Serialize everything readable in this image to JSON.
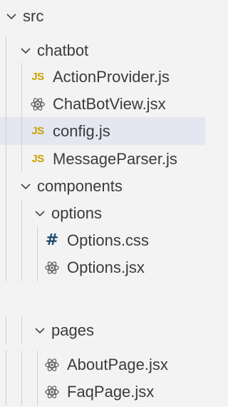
{
  "explorer": {
    "items": [
      {
        "label": "src",
        "type": "folder",
        "expanded": true
      },
      {
        "label": "chatbot",
        "type": "folder",
        "expanded": true
      },
      {
        "label": "ActionProvider.js",
        "type": "file",
        "icon": "js-icon",
        "icon_text": "JS"
      },
      {
        "label": "ChatBotView.jsx",
        "type": "file",
        "icon": "react-icon"
      },
      {
        "label": "config.js",
        "type": "file",
        "icon": "js-icon",
        "icon_text": "JS",
        "selected": true
      },
      {
        "label": "MessageParser.js",
        "type": "file",
        "icon": "js-icon",
        "icon_text": "JS"
      },
      {
        "label": "components",
        "type": "folder",
        "expanded": true
      },
      {
        "label": "options",
        "type": "folder",
        "expanded": true
      },
      {
        "label": "Options.css",
        "type": "file",
        "icon": "css-hash-icon",
        "icon_text": "#"
      },
      {
        "label": "Options.jsx",
        "type": "file",
        "icon": "react-icon"
      },
      {
        "label": "pages",
        "type": "folder",
        "expanded": true
      },
      {
        "label": "AboutPage.jsx",
        "type": "file",
        "icon": "react-icon"
      },
      {
        "label": "FaqPage.jsx",
        "type": "file",
        "icon": "react-icon"
      }
    ]
  },
  "colors": {
    "background": "#f3f3f3",
    "selected_row": "#e4e6f1",
    "text": "#3b3b3b",
    "js_icon": "#caa100",
    "css_icon": "#1f4b6e",
    "react_icon": "#5a5a5a",
    "indent_guide": "#d0d0d0"
  }
}
